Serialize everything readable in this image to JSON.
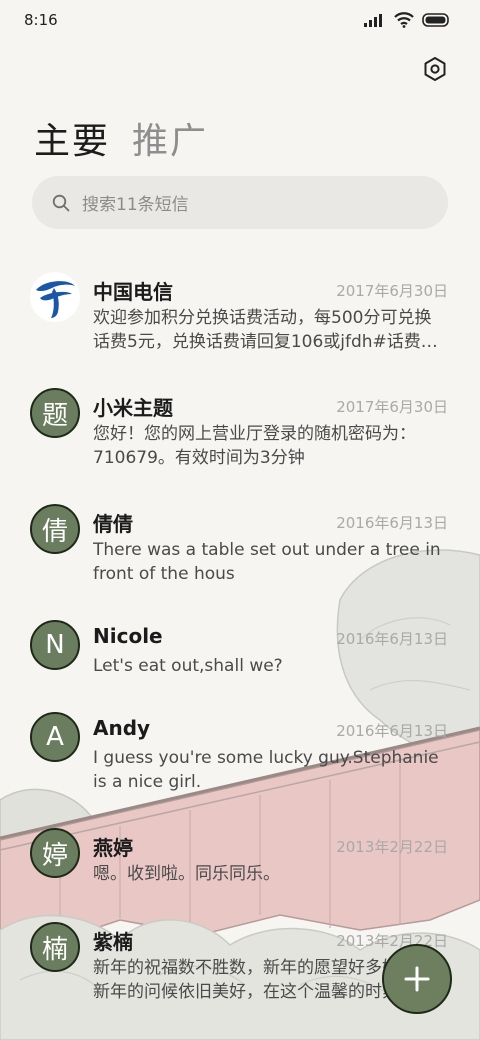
{
  "status_bar": {
    "time": "8:16"
  },
  "tabs": [
    {
      "label": "主要",
      "active": true
    },
    {
      "label": "推广",
      "active": false
    }
  ],
  "search": {
    "placeholder": "搜索11条短信"
  },
  "messages": [
    {
      "name": "中国电信",
      "date": "2017年6月30日",
      "preview": "欢迎参加积分兑换话费活动，每500分可兑换话费5元，兑换话费请回复106或jfdh#话费…",
      "avatar": "",
      "avatar_type": "logo"
    },
    {
      "name": "小米主题",
      "date": "2017年6月30日",
      "preview": "您好！您的网上营业厅登录的随机密码为：710679。有效时间为3分钟",
      "avatar": "题",
      "avatar_type": "letter"
    },
    {
      "name": "倩倩",
      "date": "2016年6月13日",
      "preview": "There was a table set out under a tree in front of the hous",
      "avatar": "倩",
      "avatar_type": "letter"
    },
    {
      "name": "Nicole",
      "date": "2016年6月13日",
      "preview": "Let's eat out,shall we?",
      "avatar": "N",
      "avatar_type": "letter"
    },
    {
      "name": "Andy",
      "date": "2016年6月13日",
      "preview": "I guess you're some lucky guy.Stephanie is a nice girl.",
      "avatar": "A",
      "avatar_type": "letter"
    },
    {
      "name": "燕婷",
      "date": "2013年2月22日",
      "preview": "嗯。收到啦。同乐同乐。",
      "avatar": "婷",
      "avatar_type": "letter"
    },
    {
      "name": "紫楠",
      "date": "2013年2月22日",
      "preview": "新年的祝福数不胜数，新年的愿望好多好多，新年的问候依旧美好，在这个温馨的时刻",
      "avatar": "楠",
      "avatar_type": "letter"
    }
  ],
  "colors": {
    "avatar_bg": "#6b7d5f",
    "fab_bg": "#6d7f5f",
    "background": "#f6f5f2"
  },
  "icons": {
    "settings": "hexagon-settings-icon",
    "search": "search-icon",
    "compose": "plus-icon"
  }
}
